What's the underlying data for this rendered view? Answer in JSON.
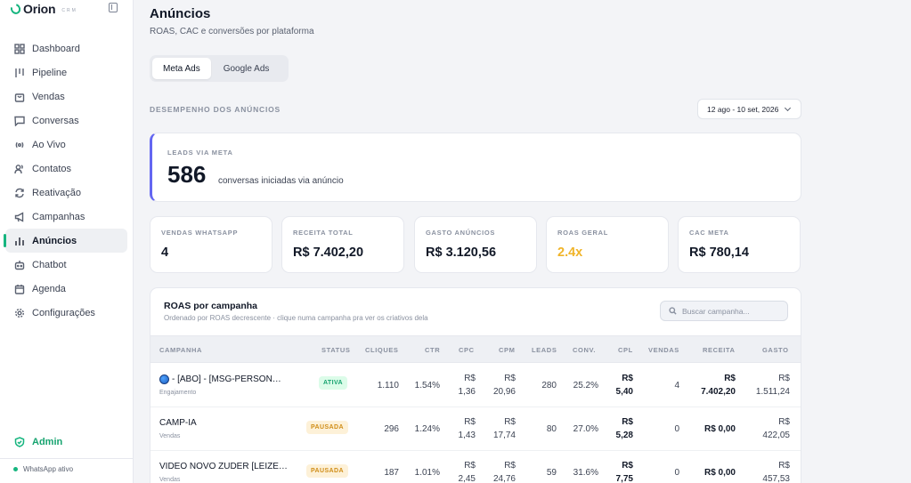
{
  "brand": {
    "name": "Orion",
    "suffix": "CRM"
  },
  "sidebar": {
    "items": [
      {
        "label": "Dashboard",
        "icon": "grid-icon"
      },
      {
        "label": "Pipeline",
        "icon": "pipeline-icon"
      },
      {
        "label": "Vendas",
        "icon": "bag-icon"
      },
      {
        "label": "Conversas",
        "icon": "chat-icon"
      },
      {
        "label": "Ao Vivo",
        "icon": "broadcast-icon"
      },
      {
        "label": "Contatos",
        "icon": "users-icon"
      },
      {
        "label": "Reativação",
        "icon": "refresh-icon"
      },
      {
        "label": "Campanhas",
        "icon": "megaphone-icon"
      },
      {
        "label": "Anúncios",
        "icon": "bar-chart-icon",
        "active": true
      },
      {
        "label": "Chatbot",
        "icon": "bot-icon"
      },
      {
        "label": "Agenda",
        "icon": "calendar-icon"
      },
      {
        "label": "Configurações",
        "icon": "gear-icon"
      }
    ],
    "admin_label": "Admin",
    "whatsapp_status": "WhatsApp ativo"
  },
  "header": {
    "title": "Anúncios",
    "subtitle": "ROAS, CAC e conversões por plataforma"
  },
  "tabs": [
    {
      "label": "Meta Ads",
      "active": true
    },
    {
      "label": "Google Ads",
      "active": false
    }
  ],
  "section": {
    "label": "DESEMPENHO DOS ANÚNCIOS",
    "date_range": "12 ago - 10 set, 2026"
  },
  "lead_card": {
    "label": "LEADS VIA META",
    "value": "586",
    "description": "conversas iniciadas via anúncio"
  },
  "kpis": [
    {
      "label": "VENDAS WHATSAPP",
      "value": "4"
    },
    {
      "label": "RECEITA TOTAL",
      "value": "R$ 7.402,20"
    },
    {
      "label": "GASTO ANÚNCIOS",
      "value": "R$ 3.120,56"
    },
    {
      "label": "ROAS GERAL",
      "value": "2.4x",
      "color": "#f0b429"
    },
    {
      "label": "CAC META",
      "value": "R$ 780,14"
    }
  ],
  "campaign_table": {
    "title": "ROAS por campanha",
    "subtitle": "Ordenado por ROAS decrescente · clique numa campanha pra ver os criativos dela",
    "search_placeholder": "Buscar campanha...",
    "columns": [
      "CAMPANHA",
      "STATUS",
      "CLIQUES",
      "CTR",
      "CPC",
      "CPM",
      "LEADS",
      "CONV.",
      "CPL",
      "VENDAS",
      "RECEITA",
      "GASTO"
    ],
    "rows": [
      {
        "name": "- [ABO] - [MSG-PERSON…",
        "has_globe": true,
        "objective": "Engajamento",
        "status": "ATIVA",
        "status_type": "on",
        "cliques": "1.110",
        "ctr": "1.54%",
        "cpc_1": "R$",
        "cpc_2": "1,36",
        "cpm_1": "R$",
        "cpm_2": "20,96",
        "leads": "280",
        "conv": "25.2%",
        "cpl_1": "R$",
        "cpl_2": "5,40",
        "vendas": "4",
        "receita_1": "R$",
        "receita_2": "7.402,20",
        "gasto_1": "R$",
        "gasto_2": "1.511,24"
      },
      {
        "name": "CAMP-IA",
        "has_globe": false,
        "objective": "Vendas",
        "status": "PAUSADA",
        "status_type": "off",
        "cliques": "296",
        "ctr": "1.24%",
        "cpc_1": "R$",
        "cpc_2": "1,43",
        "cpm_1": "R$",
        "cpm_2": "17,74",
        "leads": "80",
        "conv": "27.0%",
        "cpl_1": "R$",
        "cpl_2": "5,28",
        "vendas": "0",
        "receita_1": "",
        "receita_2": "R$ 0,00",
        "gasto_1": "R$",
        "gasto_2": "422,05"
      },
      {
        "name": "VIDEO NOVO ZUDER [LEIZE…",
        "has_globe": false,
        "objective": "Vendas",
        "status": "PAUSADA",
        "status_type": "off",
        "cliques": "187",
        "ctr": "1.01%",
        "cpc_1": "R$",
        "cpc_2": "2,45",
        "cpm_1": "R$",
        "cpm_2": "24,76",
        "leads": "59",
        "conv": "31.6%",
        "cpl_1": "R$",
        "cpl_2": "7,75",
        "vendas": "0",
        "receita_1": "",
        "receita_2": "R$ 0,00",
        "gasto_1": "R$",
        "gasto_2": "457,53"
      }
    ]
  },
  "colors": {
    "accent": "#16b57f",
    "indigo": "#6366f1",
    "warning": "#f0b429"
  }
}
